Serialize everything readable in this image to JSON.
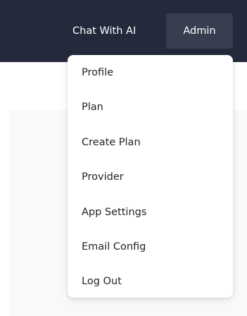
{
  "topbar": {
    "nav_link": "Chat With AI",
    "admin_label": "Admin"
  },
  "dropdown": {
    "items": [
      {
        "label": "Profile"
      },
      {
        "label": "Plan"
      },
      {
        "label": "Create Plan"
      },
      {
        "label": "Provider"
      },
      {
        "label": "App Settings"
      },
      {
        "label": "Email Config"
      },
      {
        "label": "Log Out"
      }
    ]
  },
  "colors": {
    "topbar_bg": "#242a3b",
    "admin_button_bg": "#383e4f",
    "content_bg": "#f8f9fa",
    "menu_text": "#212529"
  }
}
